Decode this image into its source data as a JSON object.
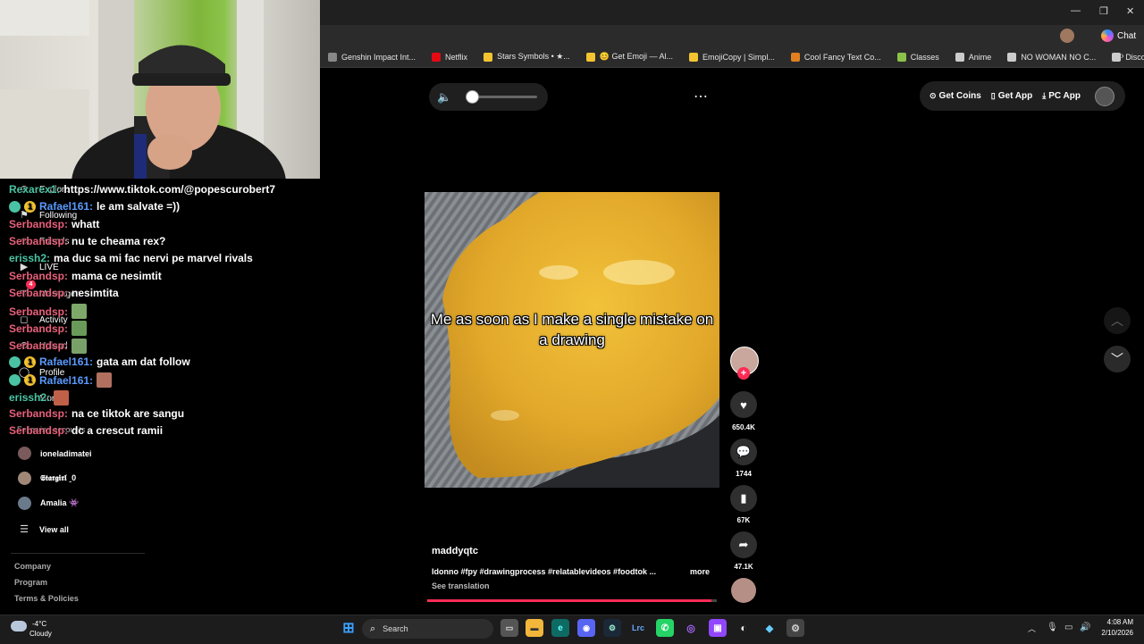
{
  "browser": {
    "bookmarks": [
      {
        "label": "Genshin Impact Int...",
        "color": "#888888"
      },
      {
        "label": "Netflix",
        "color": "#e50914"
      },
      {
        "label": "Stars Symbols • ★...",
        "color": "#f4c430"
      },
      {
        "label": "😊 Get Emoji — Al...",
        "color": "#f4c430"
      },
      {
        "label": "EmojiCopy | Simpl...",
        "color": "#f4c430"
      },
      {
        "label": "Cool Fancy Text Co...",
        "color": "#e08020"
      },
      {
        "label": "Classes",
        "color": "#8bc34a"
      },
      {
        "label": "Anime",
        "color": "#cccccc"
      },
      {
        "label": "NO WOMAN NO C...",
        "color": "#cccccc"
      },
      {
        "label": "Discord",
        "color": "#cccccc"
      }
    ],
    "chat_button_label": "Chat",
    "window_controls": [
      "minimize",
      "restore",
      "close"
    ]
  },
  "tiktok": {
    "top_actions": {
      "coins": "Get Coins",
      "app": "Get App",
      "pc_app": "PC App"
    },
    "volume_level": 0.05,
    "sidebar": {
      "nav": [
        "Explore",
        "Following",
        "Friends",
        "LIVE",
        "Messages",
        "Activity",
        "Upload",
        "Profile",
        "More"
      ],
      "messages_badge": "4",
      "following_accounts_label": "Following accounts",
      "accounts": [
        "ioneladimatei",
        "𝕾𝖙𝖆𝖗𝖌𝖎𝖗𝖑 ꞈ0",
        "Amalia 👾"
      ],
      "view_all": "View all",
      "footer": [
        "Company",
        "Program",
        "Terms & Policies"
      ]
    },
    "video": {
      "caption": "Me as soon as I make a single mistake on a drawing",
      "author": "maddyqtc",
      "description": "Idonno #fpy #drawingprocess #relatablevideos #foodtok ...",
      "more": "more",
      "see_translation": "See translation",
      "progress": 0.98
    },
    "actions": {
      "likes": "650.4K",
      "comments": "1744",
      "saves": "67K",
      "shares": "47.1K"
    }
  },
  "chat": [
    {
      "user": "Rexarex1",
      "color": "#49c3a3",
      "message": "https://www.tiktok.com/@popescurobert7",
      "badges": []
    },
    {
      "user": "Rafael161",
      "color": "#5a9bff",
      "message": "le am salvate =))",
      "badges": [
        "1"
      ]
    },
    {
      "user": "Serbandsp",
      "color": "#e8607a",
      "message": "whatt",
      "badges": []
    },
    {
      "user": "Serbandsp",
      "color": "#e8607a",
      "message": "nu te cheama rex?",
      "badges": []
    },
    {
      "user": "erissh2",
      "color": "#49c3a3",
      "message": "ma duc sa mi fac nervi pe marvel rivals",
      "badges": []
    },
    {
      "user": "Serbandsp",
      "color": "#e8607a",
      "message": "mama ce nesimtit",
      "badges": []
    },
    {
      "user": "Serbandsp",
      "color": "#e8607a",
      "message": "nesimtita",
      "badges": []
    },
    {
      "user": "Serbandsp",
      "color": "#e8607a",
      "message": "",
      "badges": [],
      "emote": true
    },
    {
      "user": "Serbandsp",
      "color": "#e8607a",
      "message": "",
      "badges": [],
      "emote": true
    },
    {
      "user": "Serbandsp",
      "color": "#e8607a",
      "message": "",
      "badges": [],
      "emote": true
    },
    {
      "user": "Rafael161",
      "color": "#5a9bff",
      "message": "gata am dat follow",
      "badges": [
        "1"
      ]
    },
    {
      "user": "Rafael161",
      "color": "#5a9bff",
      "message": "",
      "badges": [
        "1"
      ],
      "emote": true
    },
    {
      "user": "erissh2",
      "color": "#49c3a3",
      "message": "",
      "badges": [],
      "emote": true
    },
    {
      "user": "Serbandsp",
      "color": "#e8607a",
      "message": "na ce tiktok are sangu",
      "badges": []
    },
    {
      "user": "Serbandsp",
      "color": "#e8607a",
      "message": "dc a crescut ramii",
      "badges": []
    }
  ],
  "taskbar": {
    "weather_temp": "-4°C",
    "weather_desc": "Cloudy",
    "search_label": "Search",
    "time": "4:08 AM",
    "date": "2/10/2026"
  }
}
